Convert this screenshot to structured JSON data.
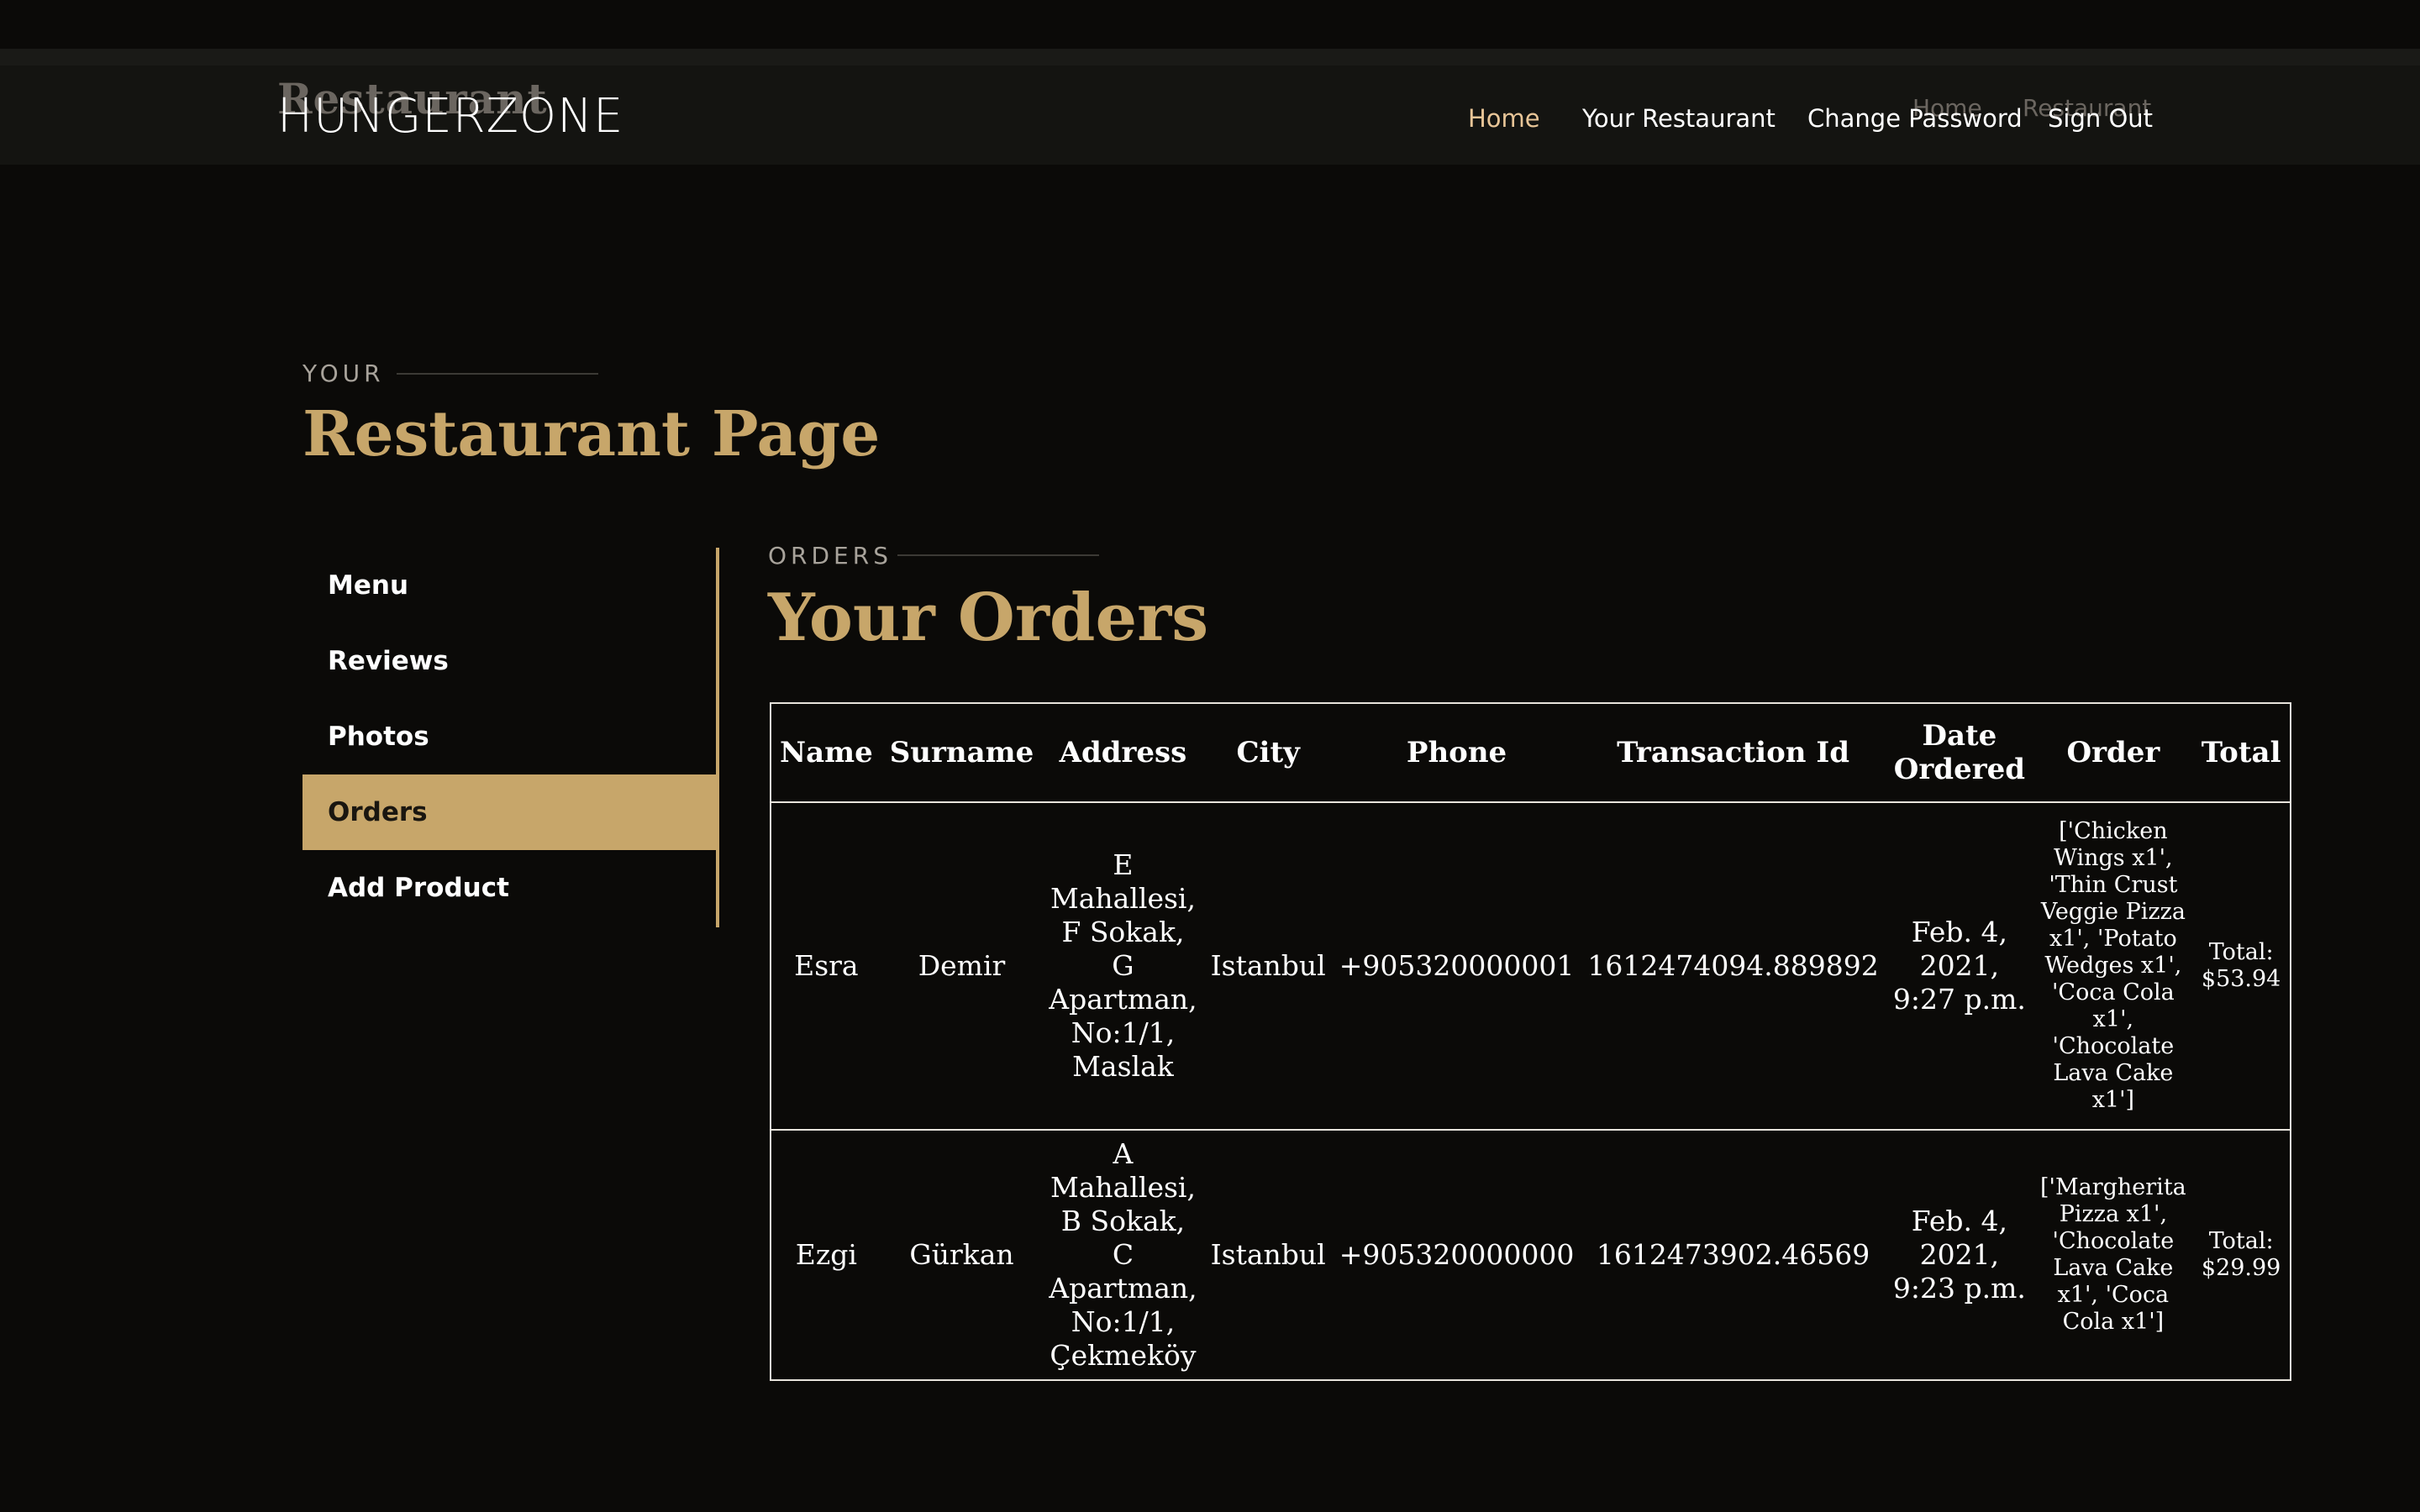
{
  "header": {
    "ghost_title": "Restaurant",
    "brand": "HUNGERZONE",
    "breadcrumb": [
      "Home",
      "Restaurant"
    ],
    "nav": [
      "Home",
      "Your Restaurant",
      "Change Password",
      "Sign Out"
    ]
  },
  "page": {
    "kicker": "YOUR",
    "title": "Restaurant Page"
  },
  "sidebar": {
    "items": [
      "Menu",
      "Reviews",
      "Photos",
      "Orders",
      "Add Product"
    ],
    "active": "Orders"
  },
  "orders": {
    "kicker": "ORDERS",
    "title": "Your Orders",
    "columns": [
      "Name",
      "Surname",
      "Address",
      "City",
      "Phone",
      "Transaction Id",
      "Date Ordered",
      "Order",
      "Total"
    ],
    "rows": [
      {
        "name": "Esra",
        "surname": "Demir",
        "address": "E Mahallesi, F Sokak, G Apartman, No:1/1, Maslak",
        "city": "Istanbul",
        "phone": "+905320000001",
        "transaction_id": "1612474094.889892",
        "date": "Feb. 4, 2021, 9:27 p.m.",
        "order": "['Chicken Wings x1', 'Thin Crust Veggie Pizza x1', 'Potato Wedges x1', 'Coca Cola x1', 'Chocolate Lava Cake x1']",
        "total": "Total: $53.94"
      },
      {
        "name": "Ezgi",
        "surname": "Gürkan",
        "address": "A Mahallesi, B Sokak, C Apartman, No:1/1, Çekmeköy",
        "city": "Istanbul",
        "phone": "+905320000000",
        "transaction_id": "1612473902.46569",
        "date": "Feb. 4, 2021, 9:23 p.m.",
        "order": "['Margherita Pizza x1', 'Chocolate Lava Cake x1', 'Coca Cola x1']",
        "total": "Total: $29.99"
      }
    ]
  },
  "colors": {
    "accent": "#c7a66a",
    "background": "#0b0a08",
    "nav_active": "#e8c597"
  }
}
